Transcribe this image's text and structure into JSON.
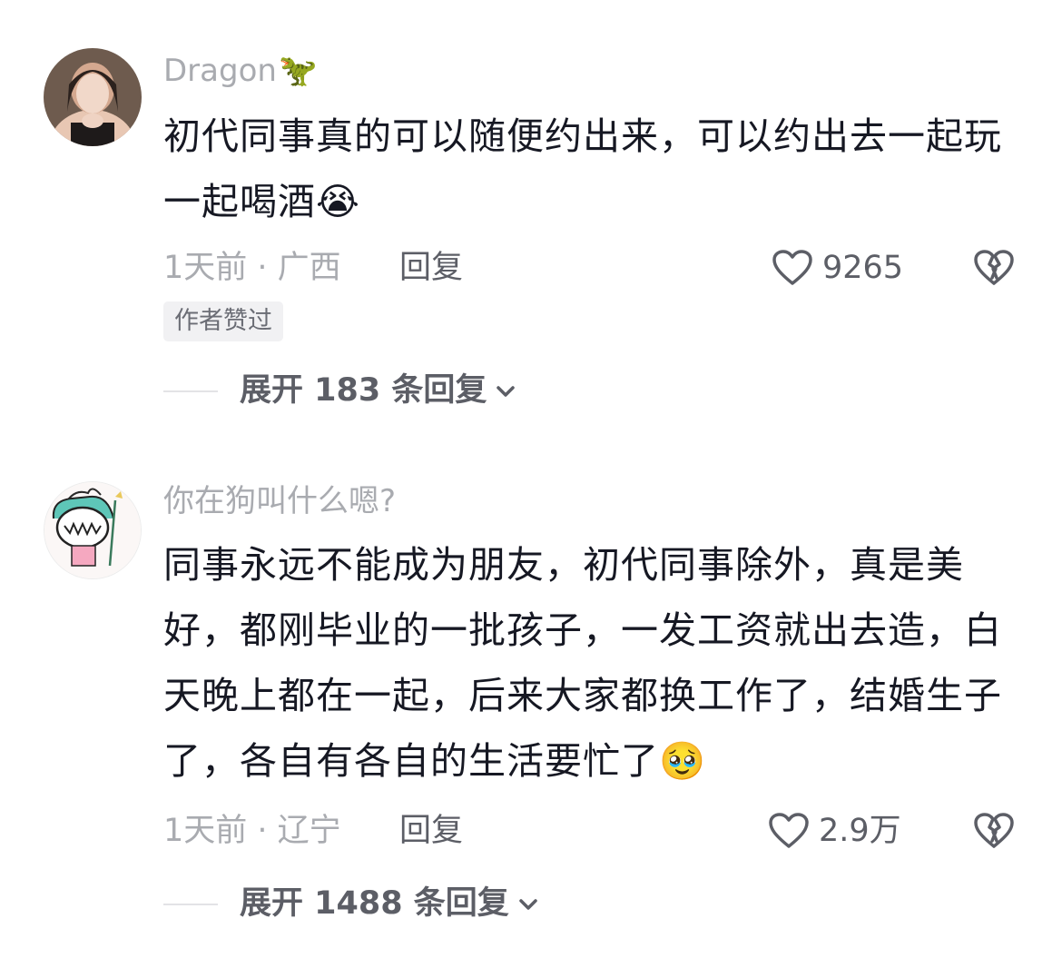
{
  "comments": [
    {
      "username": "Dragon",
      "username_emoji": "🦖",
      "text": "初代同事真的可以随便约出来，可以约出去一起玩一起喝酒😭",
      "time_location": "1天前 · 广西",
      "reply_label": "回复",
      "likes": "9265",
      "badge": "作者赞过",
      "expand_label": "展开 183 条回复"
    },
    {
      "username": "你在狗叫什么嗯?",
      "text": "同事永远不能成为朋友，初代同事除外，真是美好，都刚毕业的一批孩子，一发工资就出去造，白天晚上都在一起，后来大家都换工作了，结婚生子了，各自有各自的生活要忙了🥹",
      "time_location": "1天前 · 辽宁",
      "reply_label": "回复",
      "likes": "2.9万",
      "expand_label": "展开 1488 条回复"
    }
  ],
  "icons": {
    "like": "heart-outline-icon",
    "dislike": "broken-heart-icon",
    "expand": "chevron-down-icon"
  },
  "colors": {
    "text": "#161823",
    "muted": "#a9abb0",
    "secondary": "#5c5e66",
    "badge_bg": "#f1f1f3"
  }
}
